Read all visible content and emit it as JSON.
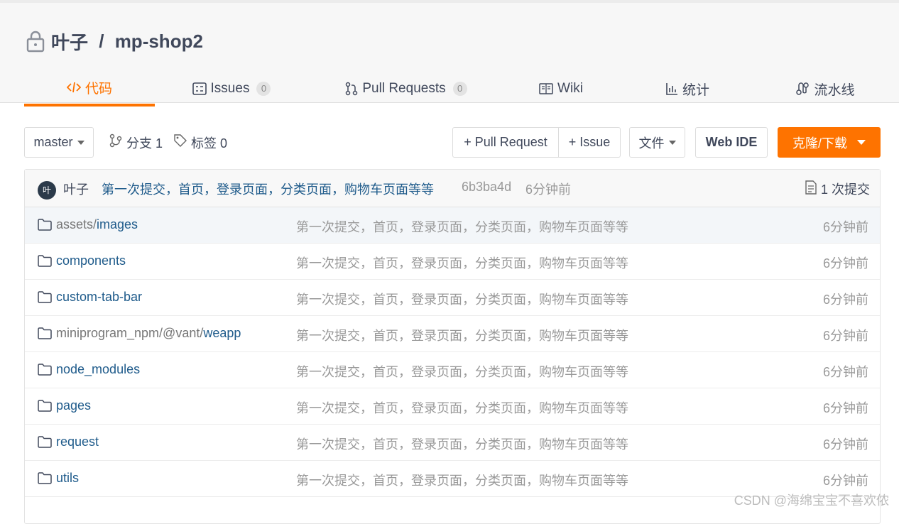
{
  "repo": {
    "owner": "叶子",
    "separator": " / ",
    "name": "mp-shop2"
  },
  "tabs": [
    {
      "label": "代码",
      "icon": "code-icon",
      "active": true
    },
    {
      "label": "Issues",
      "icon": "issues-icon",
      "count": "0"
    },
    {
      "label": "Pull Requests",
      "icon": "pull-request-icon",
      "count": "0"
    },
    {
      "label": "Wiki",
      "icon": "wiki-icon"
    },
    {
      "label": "统计",
      "icon": "stats-icon"
    },
    {
      "label": "流水线",
      "icon": "pipeline-icon"
    }
  ],
  "toolbar": {
    "branch": "master",
    "branches_label": "分支 1",
    "tags_label": "标签 0",
    "pull_request": "+ Pull Request",
    "issue": "+ Issue",
    "file": "文件",
    "web_ide": "Web IDE",
    "clone": "克隆/下载"
  },
  "commit": {
    "avatar_text": "叶",
    "author": "叶子",
    "message": "第一次提交，首页，登录页面，分类页面，购物车页面等等",
    "sha": "6b3ba4d",
    "time": "6分钟前",
    "count_label": "1 次提交"
  },
  "files": [
    {
      "dim": "assets/",
      "name": "images",
      "message": "第一次提交，首页，登录页面，分类页面，购物车页面等等",
      "time": "6分钟前"
    },
    {
      "dim": "",
      "name": "components",
      "message": "第一次提交，首页，登录页面，分类页面，购物车页面等等",
      "time": "6分钟前"
    },
    {
      "dim": "",
      "name": "custom-tab-bar",
      "message": "第一次提交，首页，登录页面，分类页面，购物车页面等等",
      "time": "6分钟前"
    },
    {
      "dim": "miniprogram_npm/@vant/",
      "name": "weapp",
      "message": "第一次提交，首页，登录页面，分类页面，购物车页面等等",
      "time": "6分钟前"
    },
    {
      "dim": "",
      "name": "node_modules",
      "message": "第一次提交，首页，登录页面，分类页面，购物车页面等等",
      "time": "6分钟前"
    },
    {
      "dim": "",
      "name": "pages",
      "message": "第一次提交，首页，登录页面，分类页面，购物车页面等等",
      "time": "6分钟前"
    },
    {
      "dim": "",
      "name": "request",
      "message": "第一次提交，首页，登录页面，分类页面，购物车页面等等",
      "time": "6分钟前"
    },
    {
      "dim": "",
      "name": "utils",
      "message": "第一次提交，首页，登录页面，分类页面，购物车页面等等",
      "time": "6分钟前"
    }
  ],
  "watermark": "CSDN @海绵宝宝不喜欢侬",
  "colors": {
    "accent": "#fe7300",
    "link": "#1f5b8b"
  }
}
